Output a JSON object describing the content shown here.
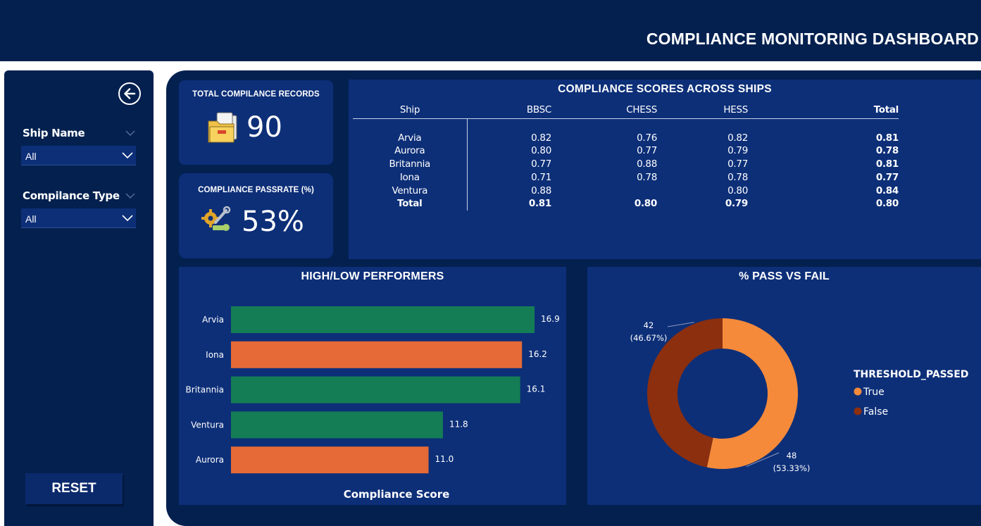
{
  "header": {
    "title": "COMPLIANCE MONITORING DASHBOARD"
  },
  "sidebar": {
    "back_icon": "arrow-left-circle-icon",
    "ship_name": {
      "label": "Ship Name",
      "value": "All"
    },
    "compliance_type": {
      "label": "Compilance Type",
      "value": "All"
    },
    "reset_label": "RESET"
  },
  "kpis": {
    "total_records": {
      "title": "TOTAL COMPILANCE RECORDS",
      "value": "90",
      "icon": "folder-icon"
    },
    "passrate": {
      "title": "COMPLIANCE PASSRATE (%)",
      "value": "53%",
      "icon": "gear-wrench-icon"
    }
  },
  "matrix": {
    "title": "COMPLIANCE SCORES ACROSS SHIPS",
    "headers": [
      "Ship",
      "BBSC",
      "CHESS",
      "HESS",
      "Total"
    ],
    "rows": [
      [
        "Arvia",
        "0.82",
        "0.76",
        "0.82",
        "0.81"
      ],
      [
        "Aurora",
        "0.80",
        "0.77",
        "0.79",
        "0.78"
      ],
      [
        "Britannia",
        "0.77",
        "0.88",
        "0.77",
        "0.81"
      ],
      [
        "Iona",
        "0.71",
        "0.78",
        "0.78",
        "0.77"
      ],
      [
        "Ventura",
        "0.88",
        "",
        "0.80",
        "0.84"
      ]
    ],
    "total_row": [
      "Total",
      "0.81",
      "0.80",
      "0.79",
      "0.80"
    ]
  },
  "colors": {
    "high": "#157d55",
    "low": "#e56a37",
    "true": "#f58a3a",
    "false": "#8b2f0f",
    "background": "#03204f",
    "card": "#0d2f78"
  },
  "chart_data": [
    {
      "type": "bar",
      "orientation": "horizontal",
      "title": "HIGH/LOW PERFORMERS",
      "xlabel": "Compliance Score",
      "ylabel": "",
      "categories": [
        "Arvia",
        "Iona",
        "Britannia",
        "Ventura",
        "Aurora"
      ],
      "values": [
        16.9,
        16.2,
        16.1,
        11.8,
        11.0
      ],
      "labels": [
        "16.9",
        "16.2",
        "16.1",
        "11.8",
        "11.0"
      ],
      "bar_colors": [
        "#157d55",
        "#e56a37",
        "#157d55",
        "#157d55",
        "#e56a37"
      ],
      "xlim": [
        0,
        17.8
      ],
      "grid": false
    },
    {
      "type": "pie",
      "donut": true,
      "title": "% PASS VS FAIL",
      "legend_title": "THRESHOLD_PASSED",
      "legend_position": "right",
      "slices": [
        {
          "name": "True",
          "value": 48,
          "label_value": "48",
          "label_pct": "(53.33%)",
          "color": "#f58a3a"
        },
        {
          "name": "False",
          "value": 42,
          "label_value": "42",
          "label_pct": "(46.67%)",
          "color": "#8b2f0f"
        }
      ]
    }
  ]
}
